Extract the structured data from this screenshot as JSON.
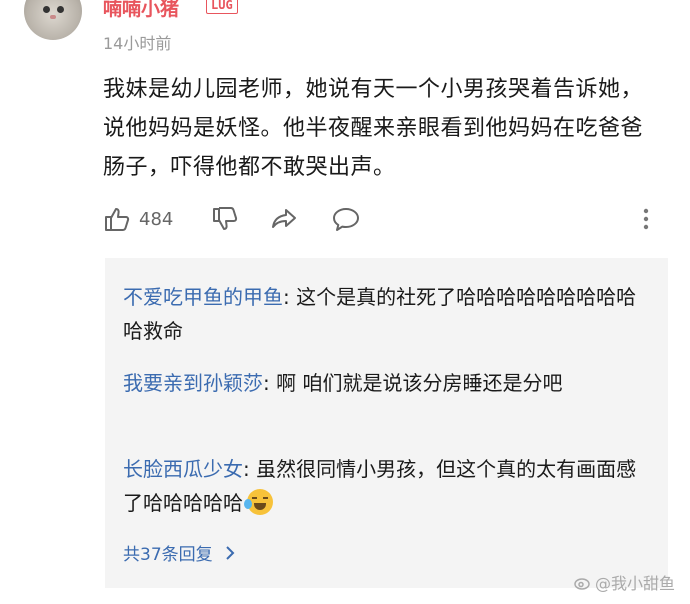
{
  "post": {
    "username": "喃喃小猪",
    "badge": "LUG",
    "time": "14小时前",
    "text": "我妹是幼儿园老师，她说有天一个小男孩哭着告诉她，说他妈妈是妖怪。他半夜醒来亲眼看到他妈妈在吃爸爸肠子，吓得他都不敢哭出声。"
  },
  "actions": {
    "like_count": "484",
    "icons": [
      "thumbs-up-icon",
      "thumbs-down-icon",
      "share-icon",
      "comment-icon",
      "more-vertical-icon"
    ]
  },
  "replies": [
    {
      "name": "不爱吃甲鱼的甲鱼",
      "text": ": 这个是真的社死了哈哈哈哈哈哈哈哈哈哈救命"
    },
    {
      "name": "我要亲到孙颖莎",
      "text": ": 啊   咱们就是说该分房睡还是分吧"
    },
    {
      "name": "长脸西瓜少女",
      "text": ": 虽然很同情小男孩，但这个真的太有画面感了哈哈哈哈哈"
    }
  ],
  "more_replies": "共37条回复",
  "watermark": "@我小甜鱼",
  "colors": {
    "username": "#e8555d",
    "link": "#3b6bb0",
    "reply_bg": "#f4f4f4"
  }
}
